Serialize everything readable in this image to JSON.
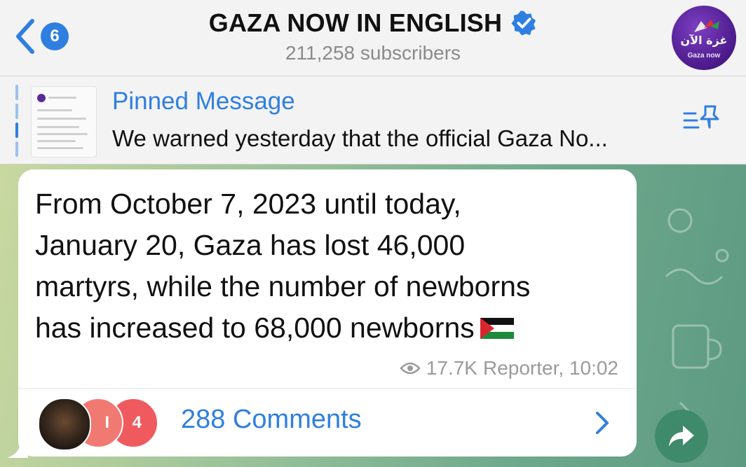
{
  "header": {
    "back_count": "6",
    "title": "GAZA NOW IN ENGLISH",
    "subscribers": "211,258 subscribers",
    "avatar_text_ar": "غزة الآن",
    "avatar_text_en": "Gaza now"
  },
  "pinned": {
    "title": "Pinned Message",
    "text": "We warned yesterday that the official Gaza No..."
  },
  "message": {
    "lines": [
      "From October 7, 2023 until today,",
      "January 20, Gaza has lost 46,000",
      "martyrs, while the number of newborns",
      "has increased to 68,000 newborns"
    ],
    "views": "17.7K",
    "author_time": "Reporter, 10:02"
  },
  "comments": {
    "label": "288 Comments",
    "avatar2_text": "I",
    "avatar3_text": "4"
  },
  "colors": {
    "accent": "#2f7fe0",
    "header_bg": "#f3f3f3",
    "share_bg": "#3f8a6a"
  },
  "icons": [
    "back-chevron-icon",
    "verified-icon",
    "pinned-list-icon",
    "eye-icon",
    "palestine-flag-icon",
    "chevron-right-icon",
    "share-arrow-icon"
  ]
}
